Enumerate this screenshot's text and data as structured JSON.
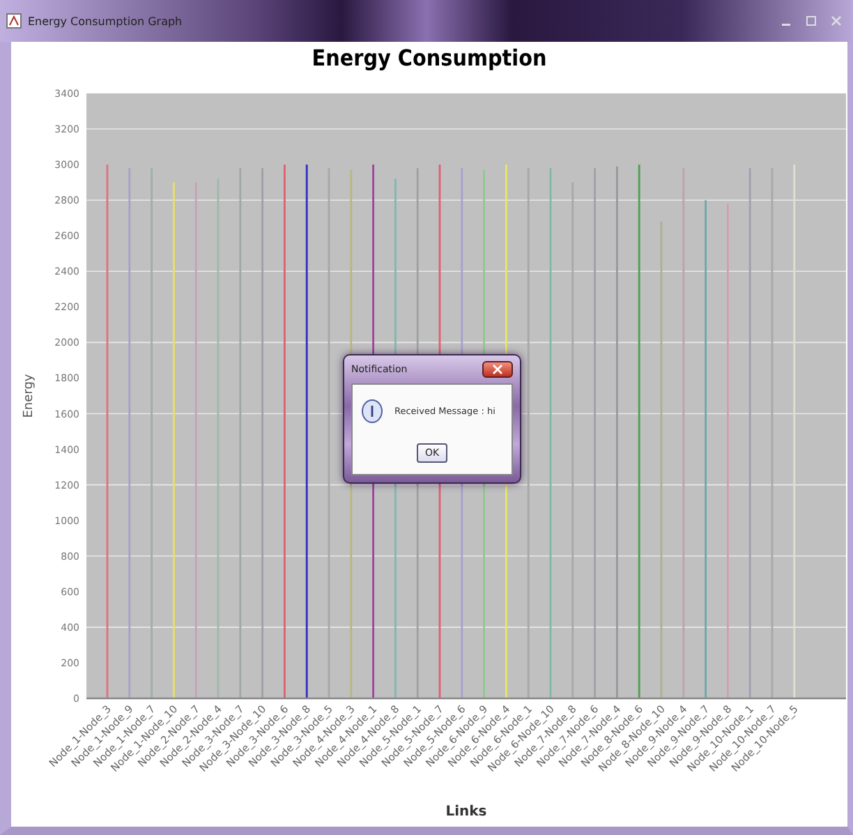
{
  "window": {
    "title": "Energy Consumption Graph"
  },
  "chart": {
    "chart_data": {
      "type": "bar",
      "title": "Energy Consumption",
      "xlabel": "Links",
      "ylabel": "Energy",
      "categories": [
        "Node_1-Node_3",
        "Node_1-Node_9",
        "Node_1-Node_7",
        "Node_1-Node_10",
        "Node_2-Node_7",
        "Node_2-Node_4",
        "Node_3-Node_7",
        "Node_3-Node_10",
        "Node_3-Node_6",
        "Node_3-Node_8",
        "Node_3-Node_5",
        "Node_4-Node_3",
        "Node_4-Node_1",
        "Node_4-Node_8",
        "Node_5-Node_1",
        "Node_5-Node_7",
        "Node_5-Node_6",
        "Node_6-Node_9",
        "Node_6-Node_4",
        "Node_6-Node_1",
        "Node_6-Node_10",
        "Node_7-Node_8",
        "Node_7-Node_6",
        "Node_7-Node_4",
        "Node_8-Node_6",
        "Node_8-Node_10",
        "Node_9-Node_4",
        "Node_9-Node_7",
        "Node_9-Node_8",
        "Node_10-Node_1",
        "Node_10-Node_7",
        "Node_10-Node_5"
      ],
      "series": [
        {
          "values": [
            3000,
            2980,
            2980,
            2900,
            2900,
            2920,
            2980,
            2980,
            3000,
            3000,
            2980,
            2970,
            3000,
            2920,
            2980,
            3000,
            2980,
            2970,
            3000,
            2980,
            2980,
            2900,
            2980,
            2990,
            3000,
            2680,
            2980,
            2800,
            2780,
            2980,
            2980,
            3000
          ],
          "colors": [
            "#e07080",
            "#a8a0c8",
            "#a0b0a8",
            "#e8e060",
            "#c8a0b8",
            "#a0b8a8",
            "#a0a8a8",
            "#a0a0a8",
            "#e06070",
            "#3030c0",
            "#a8a8a8",
            "#b8b880",
            "#a040a0",
            "#80b8b0",
            "#a0a0a0",
            "#e06070",
            "#a8a0d0",
            "#90c890",
            "#e8e860",
            "#a8a8a8",
            "#80b8a8",
            "#a8a8a8",
            "#a0a0a8",
            "#9898a0",
            "#50a050",
            "#b0b090",
            "#c0a0b0",
            "#70a8a8",
            "#d0a0b0",
            "#a0a0b0",
            "#a8a8a8",
            "#e0e0d0"
          ]
        }
      ],
      "ylim": [
        0,
        3400
      ],
      "grid": true,
      "yticks": [
        0,
        200,
        400,
        600,
        800,
        1000,
        1200,
        1400,
        1600,
        1800,
        2000,
        2200,
        2400,
        2600,
        2800,
        3000,
        3200,
        3400
      ]
    }
  },
  "dialog": {
    "title": "Notification",
    "message": "Received Message : hi",
    "buttons": [
      "OK"
    ]
  }
}
